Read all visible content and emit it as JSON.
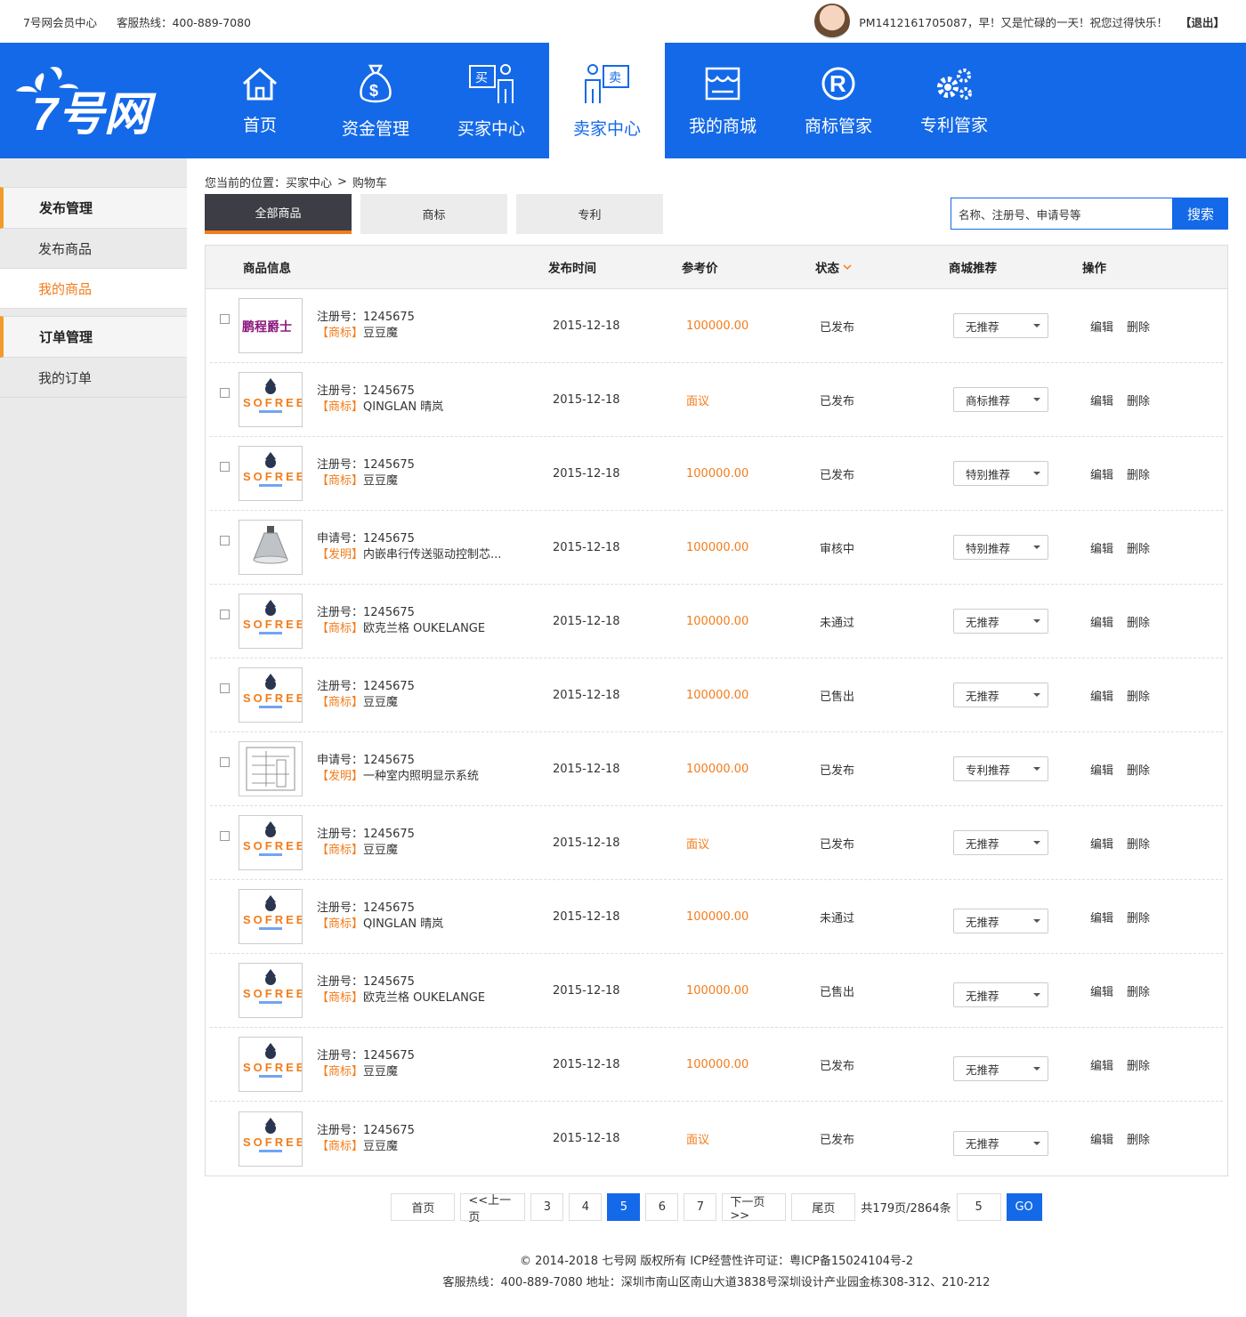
{
  "topbar": {
    "site_name": "7号网会员中心",
    "hotline": "客服热线：400-889-7080",
    "greeting": "PM1412161705087，早！又是忙碌的一天！祝您过得快乐！",
    "logout": "【退出】"
  },
  "nav": {
    "logo_text": "7号网",
    "items": [
      {
        "label": "首页",
        "icon": "home-icon"
      },
      {
        "label": "资金管理",
        "icon": "money-bag-icon"
      },
      {
        "label": "买家中心",
        "icon": "buyer-icon"
      },
      {
        "label": "卖家中心",
        "icon": "seller-icon"
      },
      {
        "label": "我的商城",
        "icon": "shop-icon"
      },
      {
        "label": "商标管家",
        "icon": "registered-icon"
      },
      {
        "label": "专利管家",
        "icon": "gears-icon"
      }
    ]
  },
  "sidebar": {
    "group1": "发布管理",
    "item1": "发布商品",
    "item2": "我的商品",
    "group2": "订单管理",
    "item3": "我的订单"
  },
  "breadcrumb": {
    "prefix": "您当前的位置：买家中心",
    "sep": ">",
    "current": "购物车"
  },
  "tabs": [
    "全部商品",
    "商标",
    "专利"
  ],
  "search": {
    "placeholder": "名称、注册号、申请号等",
    "button": "搜索"
  },
  "table": {
    "headers": {
      "info": "商品信息",
      "time": "发布时间",
      "price": "参考价",
      "status": "状态",
      "rec": "商城推荐",
      "ops": "操作"
    },
    "edit": "编辑",
    "delete": "删除",
    "rows": [
      {
        "img": "pengcheng",
        "num": "注册号：1245675",
        "tag": "【商标】",
        "name": "豆豆魔",
        "time": "2015-12-18",
        "price": "100000.00",
        "status": "已发布",
        "rec": "无推荐",
        "check": true
      },
      {
        "img": "sofree",
        "num": "注册号：1245675",
        "tag": "【商标】",
        "name": "QINGLAN 晴岚",
        "time": "2015-12-18",
        "price": "面议",
        "status": "已发布",
        "rec": "商标推荐",
        "check": true
      },
      {
        "img": "sofree",
        "num": "注册号：1245675",
        "tag": "【商标】",
        "name": "豆豆魔",
        "time": "2015-12-18",
        "price": "100000.00",
        "status": "已发布",
        "rec": "特别推荐",
        "check": true
      },
      {
        "img": "lamp",
        "num": "申请号：1245675",
        "tag": "【发明】",
        "name": "内嵌串行传送驱动控制芯...",
        "time": "2015-12-18",
        "price": "100000.00",
        "status": "审核中",
        "rec": "特别推荐",
        "check": true
      },
      {
        "img": "sofree",
        "num": "注册号：1245675",
        "tag": "【商标】",
        "name": "欧克兰格 OUKELANGE",
        "time": "2015-12-18",
        "price": "100000.00",
        "status": "未通过",
        "rec": "无推荐",
        "check": true
      },
      {
        "img": "sofree",
        "num": "注册号：1245675",
        "tag": "【商标】",
        "name": "豆豆魔",
        "time": "2015-12-18",
        "price": "100000.00",
        "status": "已售出",
        "rec": "无推荐",
        "check": true
      },
      {
        "img": "diagram",
        "num": "申请号：1245675",
        "tag": "【发明】",
        "name": "一种室内照明显示系统",
        "time": "2015-12-18",
        "price": "100000.00",
        "status": "已发布",
        "rec": "专利推荐",
        "check": true
      },
      {
        "img": "sofree",
        "num": "注册号：1245675",
        "tag": "【商标】",
        "name": "豆豆魔",
        "time": "2015-12-18",
        "price": "面议",
        "status": "已发布",
        "rec": "无推荐",
        "check": true
      },
      {
        "img": "sofree",
        "num": "注册号：1245675",
        "tag": "【商标】",
        "name": "QINGLAN 晴岚",
        "time": "2015-12-18",
        "price": "100000.00",
        "status": "未通过",
        "rec": "无推荐",
        "check": false
      },
      {
        "img": "sofree",
        "num": "注册号：1245675",
        "tag": "【商标】",
        "name": "欧克兰格 OUKELANGE",
        "time": "2015-12-18",
        "price": "100000.00",
        "status": "已售出",
        "rec": "无推荐",
        "check": false
      },
      {
        "img": "sofree",
        "num": "注册号：1245675",
        "tag": "【商标】",
        "name": "豆豆魔",
        "time": "2015-12-18",
        "price": "100000.00",
        "status": "已发布",
        "rec": "无推荐",
        "check": false
      },
      {
        "img": "sofree",
        "num": "注册号：1245675",
        "tag": "【商标】",
        "name": "豆豆魔",
        "time": "2015-12-18",
        "price": "面议",
        "status": "已发布",
        "rec": "无推荐",
        "check": false
      }
    ]
  },
  "pager": {
    "first": "首页",
    "prev": "<<上一页",
    "pages": [
      "3",
      "4",
      "5",
      "6",
      "7"
    ],
    "active": "5",
    "next": "下一页>>",
    "last": "尾页",
    "total": "共179页/2864条",
    "jump_value": "5",
    "go": "GO"
  },
  "footer": {
    "line1": "© 2014-2018 七号网 版权所有 ICP经营性许可证：粤ICP备15024104号-2",
    "line2": "客服热线：400-889-7080  地址：深圳市南山区南山大道3838号深圳设计产业园金栋308-312、210-212"
  },
  "colors": {
    "brand_blue": "#1469e8",
    "accent_orange": "#f37c1b",
    "dark_tab": "#3c3d45"
  },
  "thumbnail_text": {
    "pengcheng": "鹏程爵士",
    "sofree": "SOFREE"
  }
}
